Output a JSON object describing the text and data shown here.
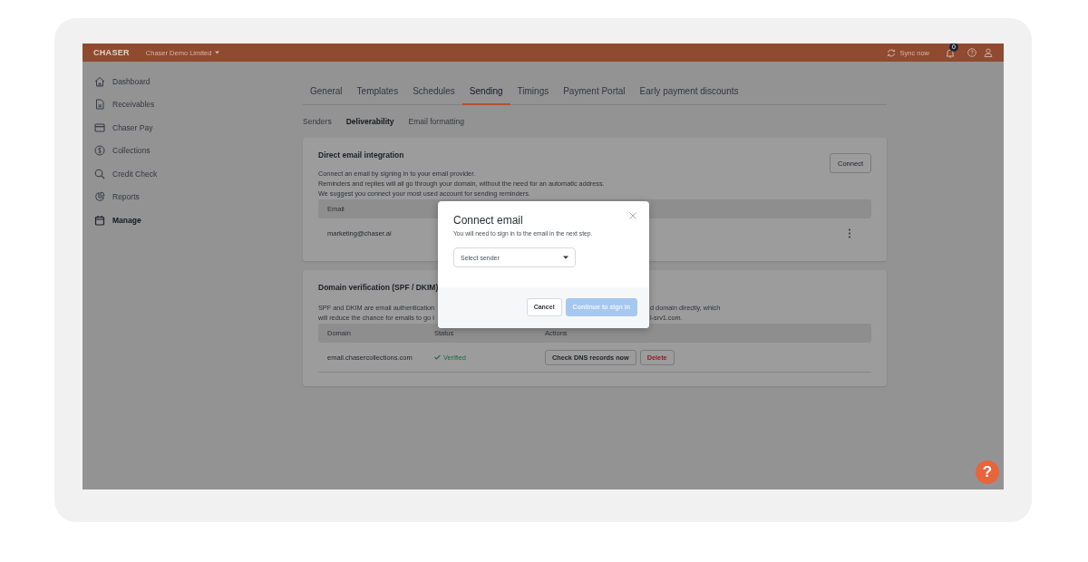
{
  "topbar": {
    "logo": "CHASER",
    "company": "Chaser Demo Limited",
    "sync": "Sync now",
    "notifications": "0"
  },
  "sidebar": {
    "items": [
      {
        "label": "Dashboard",
        "selected": false
      },
      {
        "label": "Receivables",
        "selected": false
      },
      {
        "label": "Chaser Pay",
        "selected": false
      },
      {
        "label": "Collections",
        "selected": false
      },
      {
        "label": "Credit Check",
        "selected": false
      },
      {
        "label": "Reports",
        "selected": false
      },
      {
        "label": "Manage",
        "selected": true
      }
    ]
  },
  "tabs": [
    {
      "label": "General",
      "selected": false
    },
    {
      "label": "Templates",
      "selected": false
    },
    {
      "label": "Schedules",
      "selected": false
    },
    {
      "label": "Sending",
      "selected": true
    },
    {
      "label": "Timings",
      "selected": false
    },
    {
      "label": "Payment Portal",
      "selected": false
    },
    {
      "label": "Early payment discounts",
      "selected": false
    }
  ],
  "subtabs": [
    {
      "label": "Senders",
      "selected": false
    },
    {
      "label": "Deliverability",
      "selected": true
    },
    {
      "label": "Email formatting",
      "selected": false
    }
  ],
  "email_card": {
    "title": "Direct email integration",
    "button": "Connect",
    "description": [
      "Connect an email by signing in to your email provider.",
      "Reminders and replies will all go through your domain, without the need for an automatic address.",
      "We suggest you connect your most used account for sending reminders."
    ],
    "columns": [
      "Email"
    ],
    "rows": [
      {
        "email": "marketing@chaser.ai"
      }
    ]
  },
  "domain_card": {
    "title": "Domain verification (SPF / DKIM)",
    "description_left": [
      "SPF and DKIM are email authentication",
      "will reduce the chance for emails to go i"
    ],
    "description_right": [
      "d domain directly, which",
      "l-srv1.com."
    ],
    "columns": [
      "Domain",
      "Status",
      "Actions"
    ],
    "rows": [
      {
        "domain": "email.chasercollections.com",
        "status": "Verified",
        "verified": true,
        "actions": [
          {
            "label": "Check DNS records now",
            "kind": "default"
          },
          {
            "label": "Delete",
            "kind": "danger"
          }
        ]
      }
    ]
  },
  "modal": {
    "title": "Connect email",
    "subtitle": "You will need to sign in to the email in the next step.",
    "select_placeholder": "Select sender",
    "buttons": [
      {
        "label": "Cancel",
        "kind": "secondary"
      },
      {
        "label": "Continue to sign in",
        "kind": "primary",
        "disabled": true
      }
    ]
  },
  "help": {
    "label": "?"
  }
}
